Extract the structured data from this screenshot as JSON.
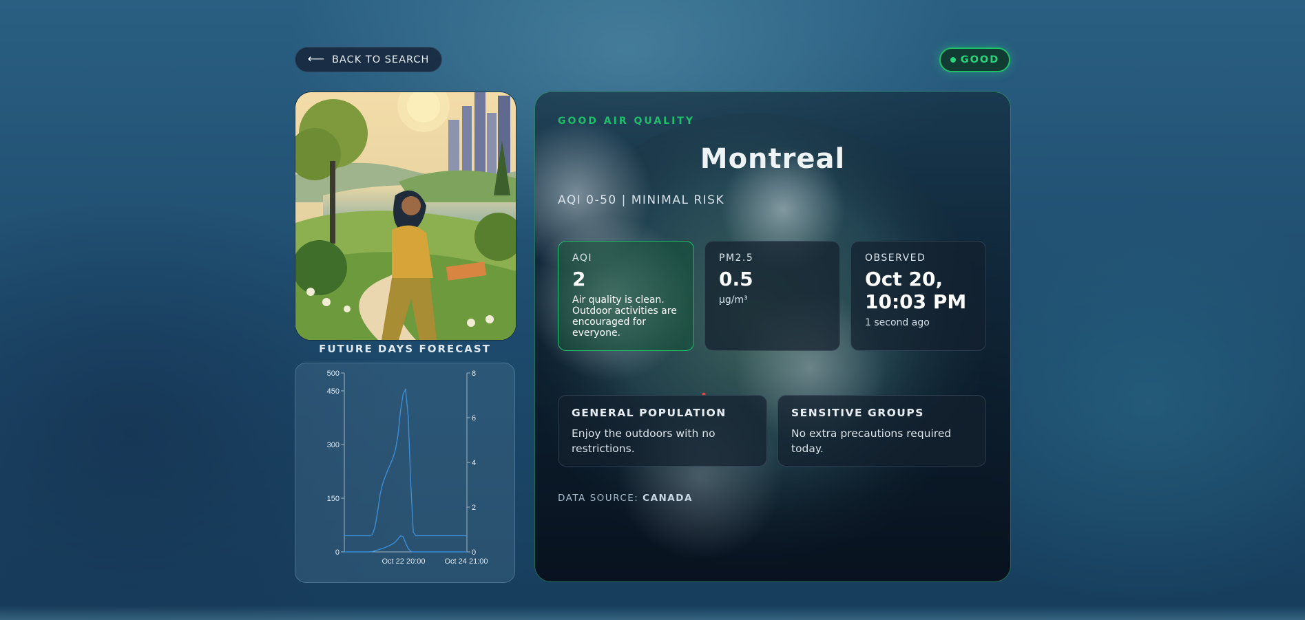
{
  "nav": {
    "back_label": "BACK TO SEARCH",
    "back_icon": "arrow-left-icon"
  },
  "status_badge": {
    "label": "GOOD",
    "color": "#1fbf6a"
  },
  "forecast": {
    "title": "FUTURE DAYS FORECAST",
    "chart_data": {
      "type": "line",
      "x_tick_labels": [
        "Oct 22 20:00",
        "Oct 24 21:00"
      ],
      "y_left": {
        "ticks": [
          0,
          150,
          300,
          450,
          500
        ],
        "ylim": [
          0,
          500
        ]
      },
      "y_right": {
        "ticks": [
          0,
          2,
          4,
          6,
          8
        ],
        "ylim": [
          0,
          8
        ]
      },
      "series": [
        {
          "axis": "left",
          "color": "#3b8ed6",
          "values": [
            45,
            45,
            45,
            45,
            45,
            45,
            45,
            45,
            45,
            45,
            45,
            48,
            70,
            110,
            160,
            190,
            210,
            228,
            245,
            262,
            285,
            325,
            395,
            440,
            455,
            380,
            195,
            55,
            45,
            45,
            45,
            45,
            45,
            45,
            45,
            45,
            45,
            45,
            45,
            45,
            45,
            45,
            45,
            45,
            45,
            45,
            45,
            45,
            45
          ]
        },
        {
          "axis": "right",
          "color": "#3b8ed6",
          "values": [
            0,
            0,
            0,
            0,
            0,
            0,
            0,
            0,
            0,
            0,
            0,
            0.02,
            0.05,
            0.08,
            0.12,
            0.16,
            0.2,
            0.25,
            0.3,
            0.36,
            0.45,
            0.58,
            0.72,
            0.68,
            0.4,
            0.15,
            0.03,
            0,
            0,
            0,
            0,
            0,
            0,
            0,
            0,
            0,
            0,
            0,
            0,
            0,
            0,
            0,
            0,
            0,
            0,
            0,
            0,
            0,
            0
          ]
        }
      ]
    }
  },
  "main": {
    "eyebrow": "GOOD AIR QUALITY",
    "city": "Montreal",
    "range": "AQI 0-50 | MINIMAL RISK",
    "aqi": {
      "label": "AQI",
      "value": "2",
      "note": "Air quality is clean. Outdoor activities are encouraged for everyone."
    },
    "pm25": {
      "label": "PM2.5",
      "value": "0.5",
      "unit": "µg/m³"
    },
    "observed": {
      "label": "OBSERVED",
      "value": "Oct 20, 10:03 PM",
      "relative": "1 second ago"
    },
    "general": {
      "title": "GENERAL POPULATION",
      "text": "Enjoy the outdoors with no restrictions."
    },
    "sensitive": {
      "title": "SENSITIVE GROUPS",
      "text": "No extra precautions required today."
    },
    "source": {
      "prefix": "DATA SOURCE:",
      "value": "CANADA"
    }
  }
}
